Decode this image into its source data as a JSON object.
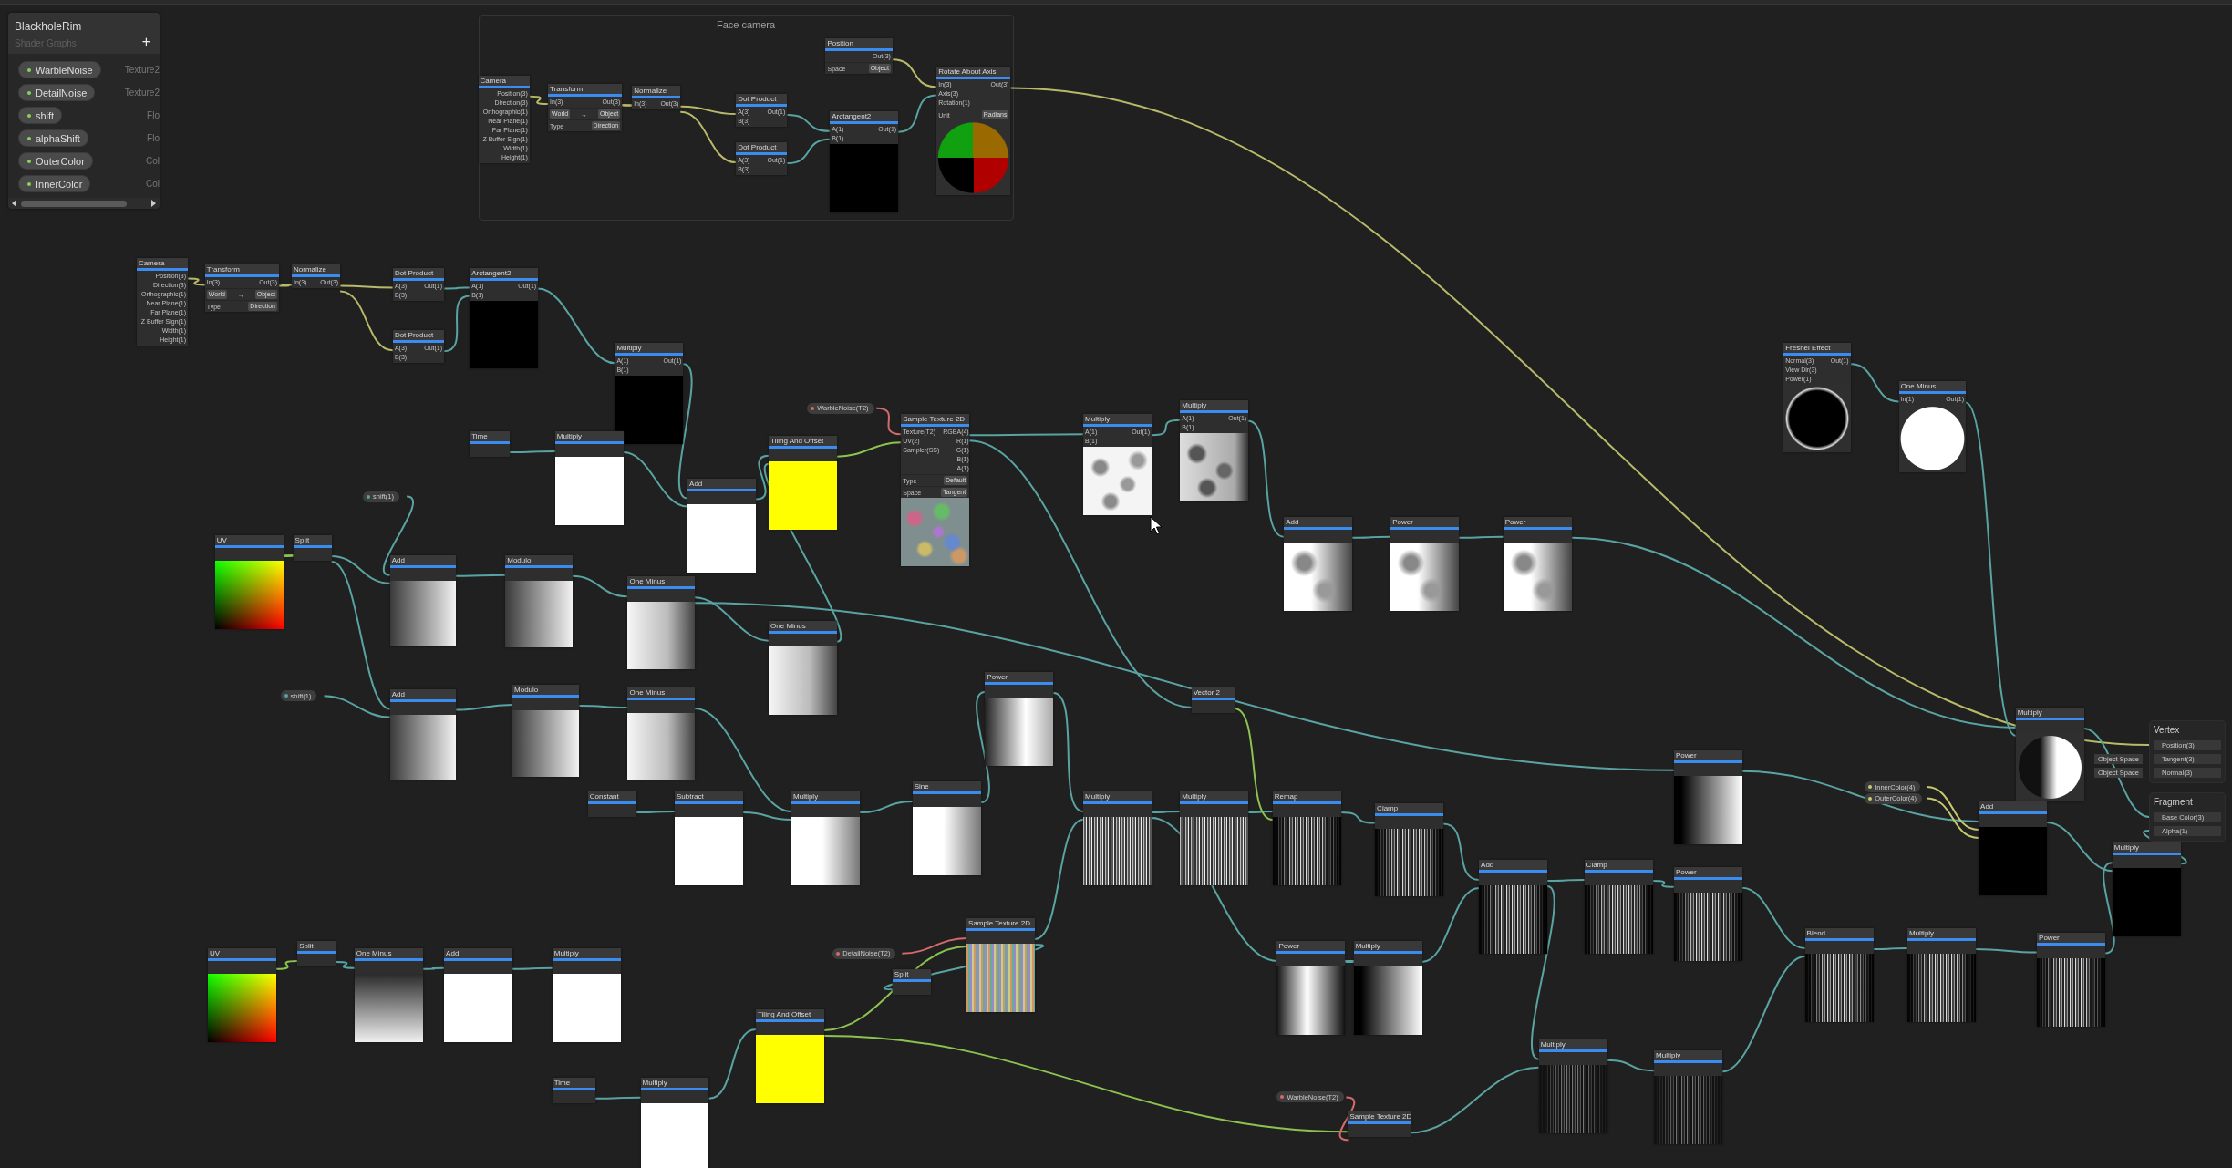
{
  "blackboard": {
    "title": "BlackholeRim",
    "subtitle": "Shader Graphs",
    "add_button": "+",
    "properties": [
      {
        "name": "WarbleNoise",
        "type": "Texture2"
      },
      {
        "name": "DetailNoise",
        "type": "Texture2"
      },
      {
        "name": "shift",
        "type": "Flo"
      },
      {
        "name": "alphaShift",
        "type": "Flo"
      },
      {
        "name": "OuterColor",
        "type": "Col"
      },
      {
        "name": "InnerColor",
        "type": "Col"
      }
    ]
  },
  "group": {
    "title": "Face camera"
  },
  "nodes": [
    {
      "title": "Camera",
      "kind": "plain",
      "outputs": [
        "Position(3)",
        "Direction(3)",
        "Orthographic(1)",
        "Near Plane(1)",
        "Far Plane(1)",
        "Z Buffer Sign(1)",
        "Width(1)",
        "Height(1)"
      ]
    },
    {
      "title": "Transform",
      "kind": "plain",
      "inputs": [
        "In(3)"
      ],
      "outputs": [
        "Out(3)"
      ],
      "conversion": {
        "from": "World",
        "arrow": "→",
        "to": "Object"
      },
      "options": [
        {
          "label": "Type",
          "value": "Direction"
        }
      ]
    },
    {
      "title": "Normalize",
      "kind": "plain",
      "inputs": [
        "In(3)"
      ],
      "outputs": [
        "Out(3)"
      ]
    },
    {
      "title": "Dot Product",
      "kind": "plain",
      "inputs": [
        "A(3)",
        "B(3)"
      ],
      "outputs": [
        "Out(1)"
      ]
    },
    {
      "title": "Dot Product",
      "kind": "plain",
      "inputs": [
        "A(3)",
        "B(3)"
      ],
      "outputs": [
        "Out(1)"
      ]
    },
    {
      "title": "Position",
      "kind": "plain",
      "outputs": [
        "Out(3)"
      ],
      "options": [
        {
          "label": "Space",
          "value": "Object"
        }
      ]
    },
    {
      "title": "Arctangent2",
      "kind": "black",
      "inputs": [
        "A(1)",
        "B(1)"
      ],
      "outputs": [
        "Out(1)"
      ]
    },
    {
      "title": "Rotate About Axis",
      "kind": "wheel",
      "inputs": [
        "In(3)",
        "Axis(3)",
        "Rotation(1)"
      ],
      "outputs": [
        "Out(3)"
      ],
      "options": [
        {
          "label": "Unit",
          "value": "Radians"
        }
      ]
    },
    {
      "title": "Camera",
      "kind": "plain",
      "outputs": [
        "Position(3)",
        "Direction(3)",
        "Orthographic(1)",
        "Near Plane(1)",
        "Far Plane(1)",
        "Z Buffer Sign(1)",
        "Width(1)",
        "Height(1)"
      ]
    },
    {
      "title": "Transform",
      "kind": "plain",
      "inputs": [
        "In(3)"
      ],
      "outputs": [
        "Out(3)"
      ],
      "conversion": {
        "from": "World",
        "arrow": "→",
        "to": "Object"
      },
      "options": [
        {
          "label": "Type",
          "value": "Direction"
        }
      ]
    },
    {
      "title": "Normalize",
      "kind": "plain",
      "inputs": [
        "In(3)"
      ],
      "outputs": [
        "Out(3)"
      ]
    },
    {
      "title": "Dot Product",
      "kind": "plain",
      "inputs": [
        "A(3)",
        "B(3)"
      ],
      "outputs": [
        "Out(1)"
      ]
    },
    {
      "title": "Dot Product",
      "kind": "plain",
      "inputs": [
        "A(3)",
        "B(3)"
      ],
      "outputs": [
        "Out(1)"
      ]
    },
    {
      "title": "Arctangent2",
      "kind": "black",
      "inputs": [
        "A(1)",
        "B(1)"
      ],
      "outputs": [
        "Out(1)"
      ]
    },
    {
      "title": "Multiply",
      "kind": "black",
      "inputs": [
        "A(1)",
        "B(1)"
      ],
      "outputs": [
        "Out(1)"
      ]
    },
    {
      "title": "Time",
      "kind": "plain"
    },
    {
      "title": "Multiply",
      "kind": "white"
    },
    {
      "title": "Add",
      "kind": "white"
    },
    {
      "title": "Tiling And Offset",
      "kind": "yellow"
    },
    {
      "title": "Sample Texture 2D",
      "kind": "noise",
      "inputs": [
        "Texture(T2)",
        "UV(2)",
        "Sampler(SS)"
      ],
      "outputs": [
        "RGBA(4)",
        "R(1)",
        "G(1)",
        "B(1)",
        "A(1)"
      ],
      "options": [
        {
          "label": "Type",
          "value": "Default"
        },
        {
          "label": "Space",
          "value": "Tangent"
        }
      ]
    },
    {
      "title": "Multiply",
      "kind": "cloud",
      "inputs": [
        "A(1)",
        "B(1)"
      ],
      "outputs": [
        "Out(1)"
      ]
    },
    {
      "title": "Multiply",
      "kind": "darkcloud",
      "inputs": [
        "A(1)",
        "B(1)"
      ],
      "outputs": [
        "Out(1)"
      ]
    },
    {
      "title": "UV",
      "kind": "uv"
    },
    {
      "title": "Split",
      "kind": "plain"
    },
    {
      "title": "Add",
      "kind": "gradient"
    },
    {
      "title": "Modulo",
      "kind": "gradient"
    },
    {
      "title": "One Minus",
      "kind": "fade"
    },
    {
      "title": "One Minus",
      "kind": "fade"
    },
    {
      "title": "Add",
      "kind": "smoke"
    },
    {
      "title": "Power",
      "kind": "smoke"
    },
    {
      "title": "Power",
      "kind": "smoke"
    },
    {
      "title": "Add",
      "kind": "gradient"
    },
    {
      "title": "Modulo",
      "kind": "gradient"
    },
    {
      "title": "One Minus",
      "kind": "fade"
    },
    {
      "title": "Power",
      "kind": "glowright"
    },
    {
      "title": "Vector 2",
      "kind": "plain"
    },
    {
      "title": "Constant",
      "kind": "plain"
    },
    {
      "title": "Subtract",
      "kind": "white"
    },
    {
      "title": "Multiply",
      "kind": "whitefade"
    },
    {
      "title": "Sine",
      "kind": "whitefade"
    },
    {
      "title": "Multiply",
      "kind": "stripes"
    },
    {
      "title": "Multiply",
      "kind": "stripes"
    },
    {
      "title": "Remap",
      "kind": "darkstripes"
    },
    {
      "title": "Clamp",
      "kind": "darkstripes"
    },
    {
      "title": "Power",
      "kind": "darkfade"
    },
    {
      "title": "Multiply",
      "kind": "halfmoon"
    },
    {
      "title": "Add",
      "kind": "black"
    },
    {
      "title": "Multiply",
      "kind": "black"
    },
    {
      "title": "Add",
      "kind": "darkstripes"
    },
    {
      "title": "Clamp",
      "kind": "darkstripes"
    },
    {
      "title": "Power",
      "kind": "darkstripes"
    },
    {
      "title": "Power",
      "kind": "glow"
    },
    {
      "title": "Multiply",
      "kind": "darkfade"
    },
    {
      "title": "Sample Texture 2D",
      "kind": "colorstripes"
    },
    {
      "title": "Split",
      "kind": "plain"
    },
    {
      "title": "Tiling And Offset",
      "kind": "yellow"
    },
    {
      "title": "Time",
      "kind": "plain"
    },
    {
      "title": "Multiply",
      "kind": "white"
    },
    {
      "title": "UV",
      "kind": "uv"
    },
    {
      "title": "Split",
      "kind": "plain"
    },
    {
      "title": "One Minus",
      "kind": "vgradient"
    },
    {
      "title": "Add",
      "kind": "white"
    },
    {
      "title": "Multiply",
      "kind": "white"
    },
    {
      "title": "Fresnel Effect",
      "kind": "blackcircle",
      "inputs": [
        "Normal(3)",
        "View Dir(3)",
        "Power(1)"
      ],
      "outputs": [
        "Out(1)"
      ]
    },
    {
      "title": "One Minus",
      "kind": "whitecircle",
      "inputs": [
        "In(1)"
      ],
      "outputs": [
        "Out(1)"
      ]
    },
    {
      "title": "Multiply",
      "kind": "faintstripes"
    },
    {
      "title": "Multiply",
      "kind": "faintstripes"
    },
    {
      "title": "Blend",
      "kind": "darkstripes"
    },
    {
      "title": "Multiply",
      "kind": "darkstripes"
    },
    {
      "title": "Power",
      "kind": "darkstripes"
    },
    {
      "title": "Sample Texture 2D",
      "kind": "plain"
    }
  ],
  "property_nodes": [
    {
      "name": "WarbleNoise(T2)",
      "kind": "texture"
    },
    {
      "name": "shift(1)",
      "kind": "float"
    },
    {
      "name": "shift(1)",
      "kind": "float"
    },
    {
      "name": "InnerColor(4)",
      "kind": "color"
    },
    {
      "name": "OuterColor(4)",
      "kind": "color"
    },
    {
      "name": "DetailNoise(T2)",
      "kind": "texture"
    },
    {
      "name": "WarbleNoise(T2)",
      "kind": "texture"
    }
  ],
  "master": {
    "sections": [
      {
        "title": "Vertex",
        "ports": [
          {
            "label": "Position(3)"
          },
          {
            "label": "Tangent(3)",
            "default": "Object Space"
          },
          {
            "label": "Normal(3)",
            "default": "Object Space"
          }
        ]
      },
      {
        "title": "Fragment",
        "ports": [
          {
            "label": "Base Color(3)"
          },
          {
            "label": "Alpha(1)"
          }
        ]
      }
    ]
  }
}
